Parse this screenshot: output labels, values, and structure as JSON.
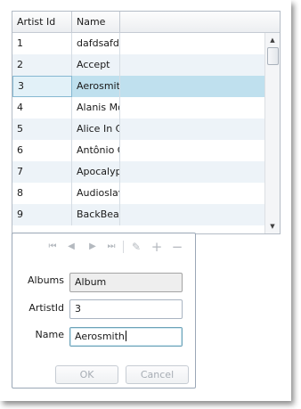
{
  "grid": {
    "columns": [
      "Artist Id",
      "Name"
    ],
    "rows": [
      {
        "id": "1",
        "name": "dafdsafdsa"
      },
      {
        "id": "2",
        "name": "Accept"
      },
      {
        "id": "3",
        "name": "Aerosmith"
      },
      {
        "id": "4",
        "name": "Alanis Morissette"
      },
      {
        "id": "5",
        "name": "Alice In Chains"
      },
      {
        "id": "6",
        "name": "Antônio Carlos Jobim"
      },
      {
        "id": "7",
        "name": "Apocalyptica"
      },
      {
        "id": "8",
        "name": "Audioslave"
      },
      {
        "id": "9",
        "name": "BackBeat"
      }
    ],
    "selected_row": 3,
    "scroll_up_glyph": "▲",
    "scroll_down_glyph": "▼"
  },
  "form": {
    "navigation": {
      "first_glyph": "⏮",
      "prev_glyph": "◀",
      "next_glyph": "▶",
      "last_glyph": "⏭",
      "edit_glyph": "✎",
      "add_glyph": "+",
      "delete_glyph": "−"
    },
    "albums_label": "Albums",
    "albums_value": "Album",
    "artistid_label": "ArtistId",
    "artistid_value": "3",
    "name_label": "Name",
    "name_value": "Aerosmith",
    "ok_label": "OK",
    "cancel_label": "Cancel"
  }
}
